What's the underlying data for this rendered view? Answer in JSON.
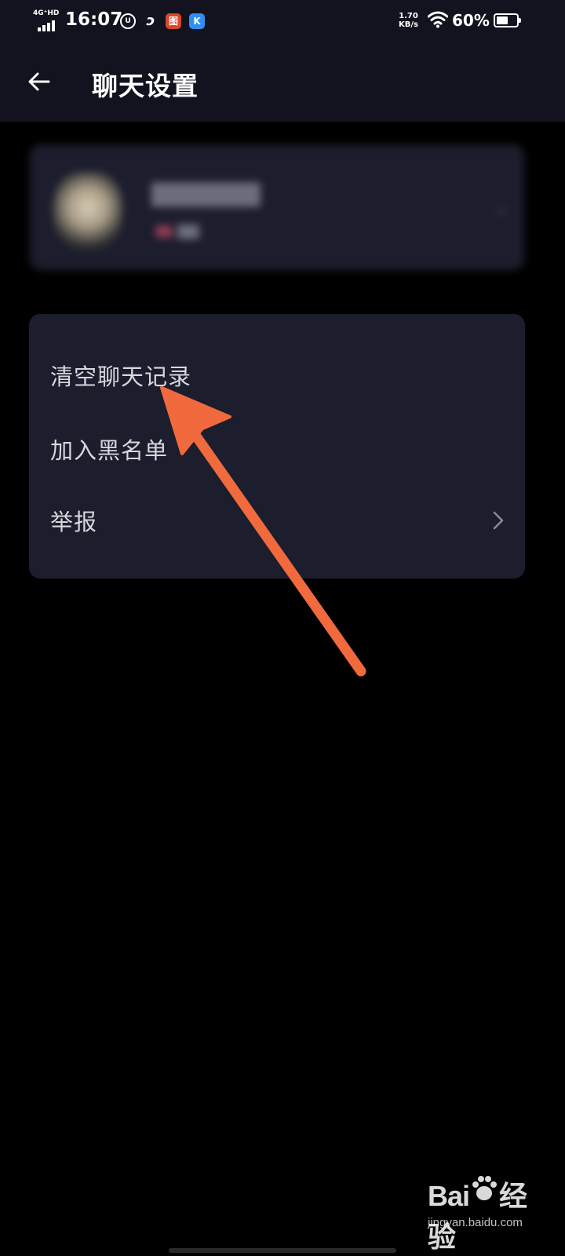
{
  "status_bar": {
    "network": "4G⁺HD",
    "time": "16:07",
    "speed_value": "1.70",
    "speed_unit": "KB/s",
    "battery_percent": "60%",
    "battery_level": 0.6,
    "app_icons": [
      "unicom-icon",
      "swirl-app-icon",
      "red-app-icon",
      "k-app-icon"
    ]
  },
  "header": {
    "title": "聊天设置",
    "back_icon": "arrow-left-icon"
  },
  "settings": {
    "items": [
      {
        "label": "清空聊天记录",
        "has_chevron": false
      },
      {
        "label": "加入黑名单",
        "has_chevron": false
      },
      {
        "label": "举报",
        "has_chevron": true
      }
    ]
  },
  "watermark": {
    "logo": "Bai",
    "logo_suffix": "经验",
    "url": "jingyan.baidu.com"
  },
  "colors": {
    "background": "#000000",
    "header_bg": "#12131f",
    "card_bg": "#1c1d2d",
    "text_primary": "#d7d7dd",
    "annotation_arrow": "#f06a3e"
  }
}
